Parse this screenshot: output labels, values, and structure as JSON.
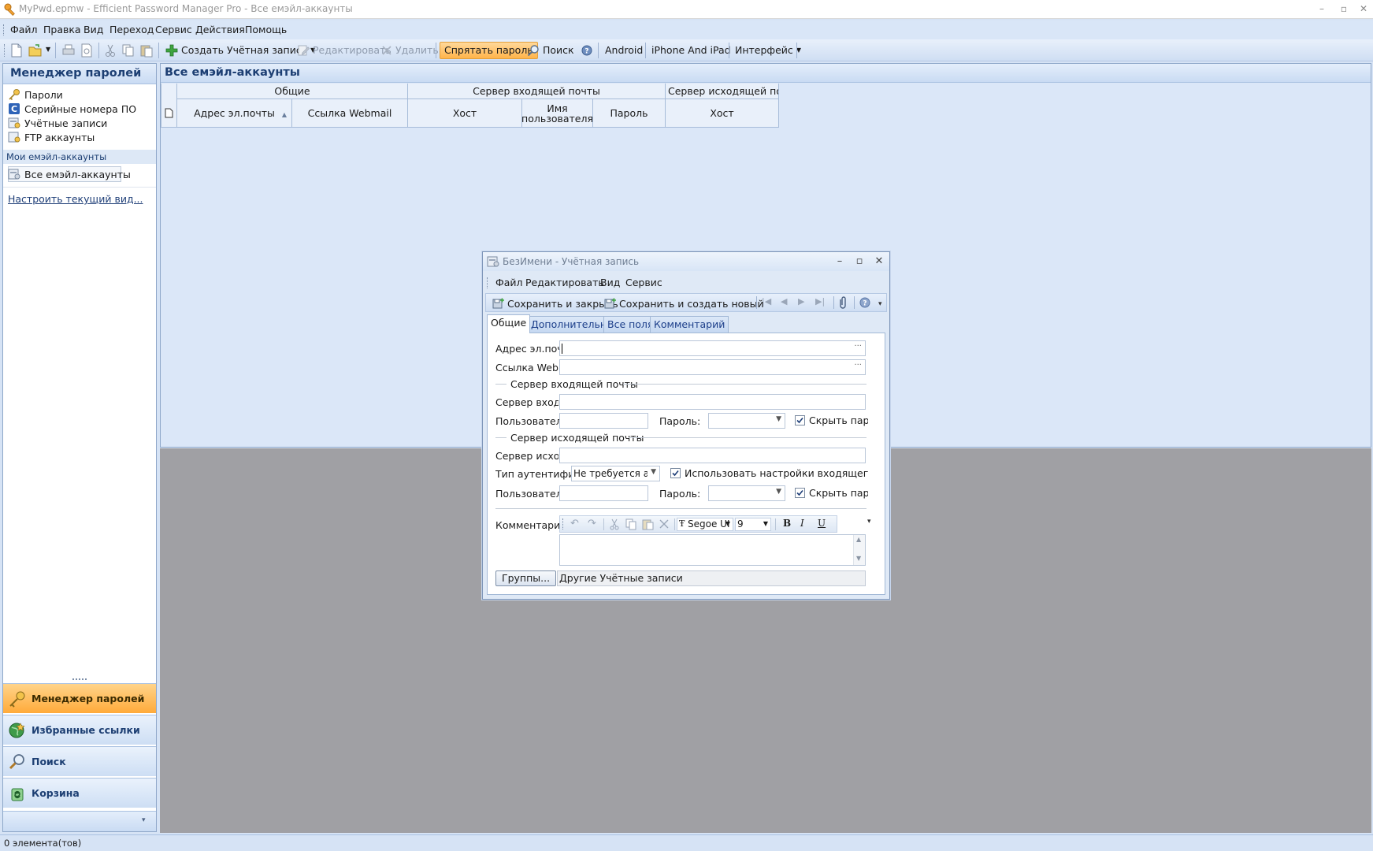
{
  "window": {
    "title": "MyPwd.epmw - Efficient Password Manager Pro - Все емэйл-аккаунты",
    "minimize": "–",
    "maximize": "▫",
    "close": "✕"
  },
  "menubar": [
    {
      "label": "Файл"
    },
    {
      "label": "Правка"
    },
    {
      "label": "Вид"
    },
    {
      "label": "Переход"
    },
    {
      "label": "Сервис"
    },
    {
      "label": "Действия"
    },
    {
      "label": "Помощь"
    }
  ],
  "toolbar": {
    "create_label": "Создать Учётная запись",
    "edit_label": "Редактировать",
    "delete_label": "Удалить",
    "hide_password_label": "Спрятать пароль",
    "search_label": "Поиск",
    "android_label": "Android",
    "iphone_label": "iPhone And iPad",
    "interface_label": "Интерфейс"
  },
  "left_panel": {
    "title": "Менеджер паролей",
    "items": [
      {
        "label": "Пароли"
      },
      {
        "label": "Серийные номера ПО"
      },
      {
        "label": "Учётные записи"
      },
      {
        "label": "FTP аккаунты"
      }
    ],
    "group_title": "Мои емэйл-аккаунты",
    "selected_item": "Все емэйл-аккаунты",
    "customize_link": "Настроить текущий вид...",
    "nav_buttons": [
      {
        "label": "Менеджер паролей"
      },
      {
        "label": "Избранные ссылки"
      },
      {
        "label": "Поиск"
      },
      {
        "label": "Корзина"
      }
    ]
  },
  "main_panel": {
    "title": "Все емэйл-аккаунты",
    "grid": {
      "group_general": "Общие",
      "group_incoming": "Сервер входящей почты",
      "group_outgoing": "Сервер исходящей почть",
      "col_email": "Адрес эл.почты",
      "col_webmail": "Ссылка Webmail",
      "col_in_host": "Хост",
      "col_in_user": "Имя пользователя",
      "col_in_password": "Пароль",
      "col_out_host": "Хост"
    }
  },
  "status_bar": {
    "text": "0 элемента(тов)"
  },
  "dialog": {
    "title": "БезИмени - Учётная запись",
    "menu": [
      {
        "label": "Файл"
      },
      {
        "label": "Редактировать"
      },
      {
        "label": "Вид"
      },
      {
        "label": "Сервис"
      }
    ],
    "toolbar": {
      "save_close": "Сохранить и закрыть",
      "save_new": "Сохранить и создать новый"
    },
    "tabs": [
      {
        "label": "Общие"
      },
      {
        "label": "Дополнительно"
      },
      {
        "label": "Все поля"
      },
      {
        "label": "Комментарий"
      }
    ],
    "form": {
      "email_label": "Адрес эл.почты",
      "email_value": "",
      "webmail_label": "Ссылка Webmail",
      "webmail_value": "",
      "incoming_group": "Сервер входящей почты",
      "incoming_server_label": "Сервер входящей почты",
      "incoming_user_label": "Пользователь:",
      "incoming_password_label": "Пароль:",
      "incoming_hide_password": "Скрыть пароль",
      "outgoing_group": "Сервер исходящей почты",
      "outgoing_server_label": "Сервер исходящей почты",
      "auth_type_label": "Тип аутентификации",
      "auth_type_value": "Не требуется аутентификация",
      "use_incoming_settings": "Использовать настройки входящего сервера",
      "outgoing_user_label": "Пользователь:",
      "outgoing_password_label": "Пароль:",
      "outgoing_hide_password": "Скрыть пароль",
      "comment_label": "Комментарий:",
      "font_name": "Segoe UI",
      "font_size": "9",
      "bold": "B",
      "italic": "I",
      "underline": "U",
      "groups_button": "Группы...",
      "groups_value": "Другие Учётные записи"
    }
  }
}
